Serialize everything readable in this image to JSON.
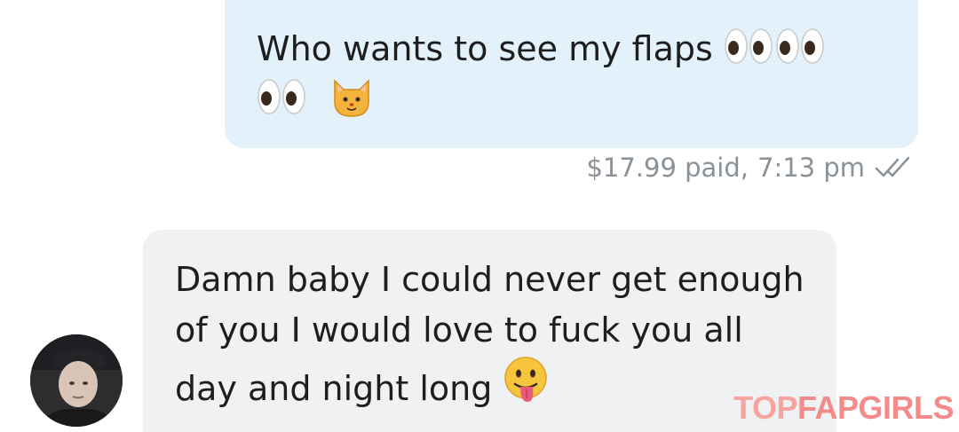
{
  "messages": [
    {
      "direction": "outgoing",
      "text": "Who wants to see my flaps",
      "emoji": [
        "eyes",
        "eyes",
        "eyes",
        "cat-face"
      ],
      "price": "$17.99 paid,",
      "time": "7:13 pm",
      "status_icon": "double-check-icon"
    },
    {
      "direction": "incoming",
      "text": "Damn baby I could never get enough of you I would love to fuck you all day and night long",
      "emoji": [
        "face-with-tongue"
      ],
      "avatar_icon": "avatar"
    }
  ],
  "watermark": {
    "part1": "TOP",
    "part2": "FAPGIRLS"
  },
  "colors": {
    "outgoing_bubble": "#e2f1fa",
    "incoming_bubble": "#f0f1f3",
    "meta_text": "#8a9299",
    "watermark": "#f48b8b"
  }
}
